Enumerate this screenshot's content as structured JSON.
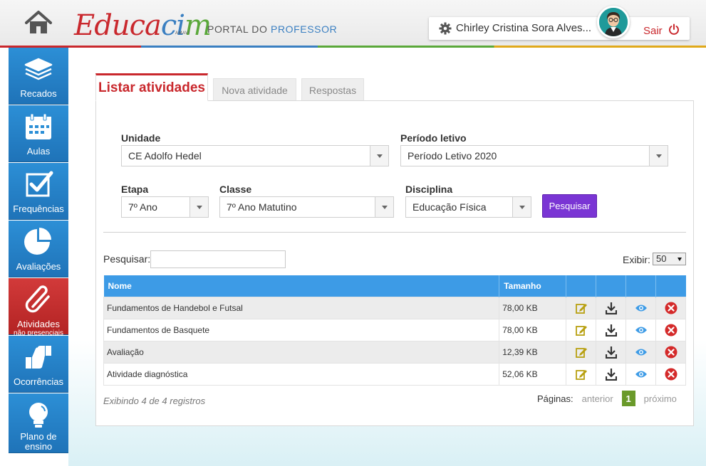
{
  "header": {
    "logo_text_red": "Educa",
    "logo_text_blue": "ci",
    "logo_text_green": "m",
    "logo_sub": "AMAVI",
    "portal_prefix": "Portal do",
    "portal_highlight": "Professor",
    "user_name": "Chirley Cristina Sora Alves...",
    "logout_label": "Sair"
  },
  "sidebar": {
    "items": [
      {
        "label": "Recados",
        "icon": "stack-icon"
      },
      {
        "label": "Aulas",
        "icon": "calendar-icon"
      },
      {
        "label": "Frequências",
        "icon": "checkbox-icon"
      },
      {
        "label": "Avaliações",
        "icon": "pie-chart-icon"
      },
      {
        "label": "Atividades",
        "sub": "não presenciais",
        "icon": "paperclip-icon"
      },
      {
        "label": "Ocorrências",
        "icon": "thumbs-icon"
      },
      {
        "label": "Plano de ensino",
        "icon": "lightbulb-icon"
      }
    ]
  },
  "tabs": [
    {
      "label": "Listar atividades",
      "active": true
    },
    {
      "label": "Nova atividade",
      "active": false
    },
    {
      "label": "Respostas",
      "active": false
    }
  ],
  "filters": {
    "unidade_label": "Unidade",
    "unidade_value": "CE Adolfo Hedel",
    "periodo_label": "Período letivo",
    "periodo_value": "Período Letivo 2020",
    "etapa_label": "Etapa",
    "etapa_value": "7º Ano",
    "classe_label": "Classe",
    "classe_value": "7º Ano Matutino",
    "disciplina_label": "Disciplina",
    "disciplina_value": "Educação Física",
    "search_button": "Pesquisar"
  },
  "list": {
    "search_label": "Pesquisar:",
    "search_value": "",
    "show_label": "Exibir:",
    "show_value": "50",
    "columns": [
      "Nome",
      "Tamanho"
    ],
    "rows": [
      {
        "nome": "Fundamentos de Handebol e Futsal",
        "tamanho": "78,00 KB"
      },
      {
        "nome": "Fundamentos de Basquete",
        "tamanho": "78,00 KB"
      },
      {
        "nome": "Avaliação",
        "tamanho": "12,39 KB"
      },
      {
        "nome": "Atividade diagnóstica",
        "tamanho": "52,06 KB"
      }
    ],
    "info": "Exibindo 4 de 4 registros",
    "pages_label": "Páginas:",
    "prev": "anterior",
    "current_page": "1",
    "next": "próximo"
  },
  "colors": {
    "brand_red": "#c9282d",
    "brand_blue": "#3a7fc1",
    "sidebar_blue": "#2c8fd6",
    "table_header": "#3d9be6",
    "button_purple": "#7a35d4"
  }
}
